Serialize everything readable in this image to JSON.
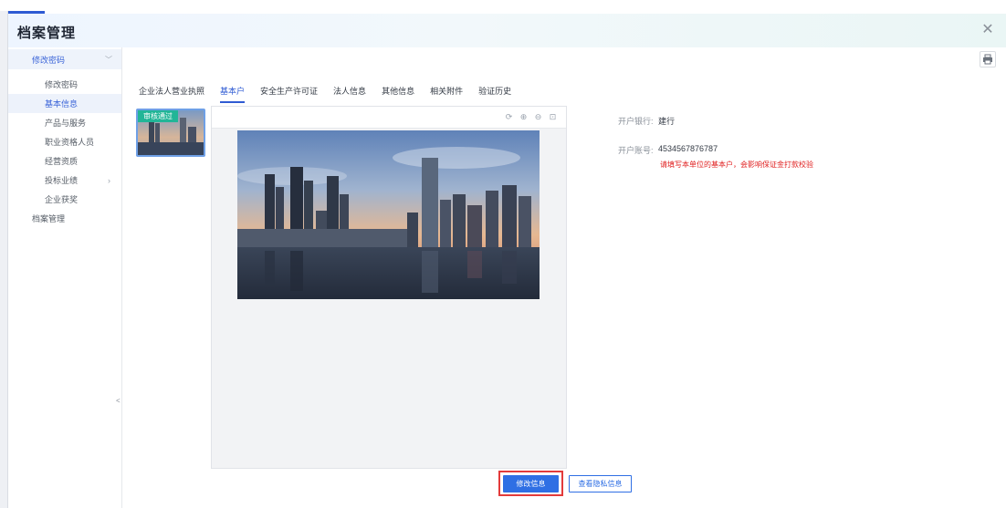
{
  "window": {
    "title": "档案管理"
  },
  "sidebar": {
    "group": {
      "label": "修改密码"
    },
    "items": [
      {
        "label": "修改密码"
      },
      {
        "label": "基本信息"
      },
      {
        "label": "产品与服务"
      },
      {
        "label": "职业资格人员"
      },
      {
        "label": "经营资质"
      },
      {
        "label": "投标业绩"
      },
      {
        "label": "企业获奖"
      }
    ],
    "root_item": {
      "label": "档案管理"
    },
    "collapse_label": "<"
  },
  "tabs": [
    {
      "label": "企业法人营业执照"
    },
    {
      "label": "基本户"
    },
    {
      "label": "安全生产许可证"
    },
    {
      "label": "法人信息"
    },
    {
      "label": "其他信息"
    },
    {
      "label": "相关附件"
    },
    {
      "label": "验证历史"
    }
  ],
  "thumbnail": {
    "badge": "审核通过"
  },
  "info": {
    "bank_label": "开户银行:",
    "bank_value": "建行",
    "account_label": "开户账号:",
    "account_value": "4534567876787",
    "warning": "请填写本单位的基本户，会影响保证金打款校验"
  },
  "actions": {
    "edit_label": "修改信息",
    "view_private_label": "查看隐私信息"
  },
  "colors": {
    "accent": "#2f5bd3",
    "badge": "#22b597",
    "warning": "#e02020",
    "highlight_box": "#e33b3b"
  }
}
